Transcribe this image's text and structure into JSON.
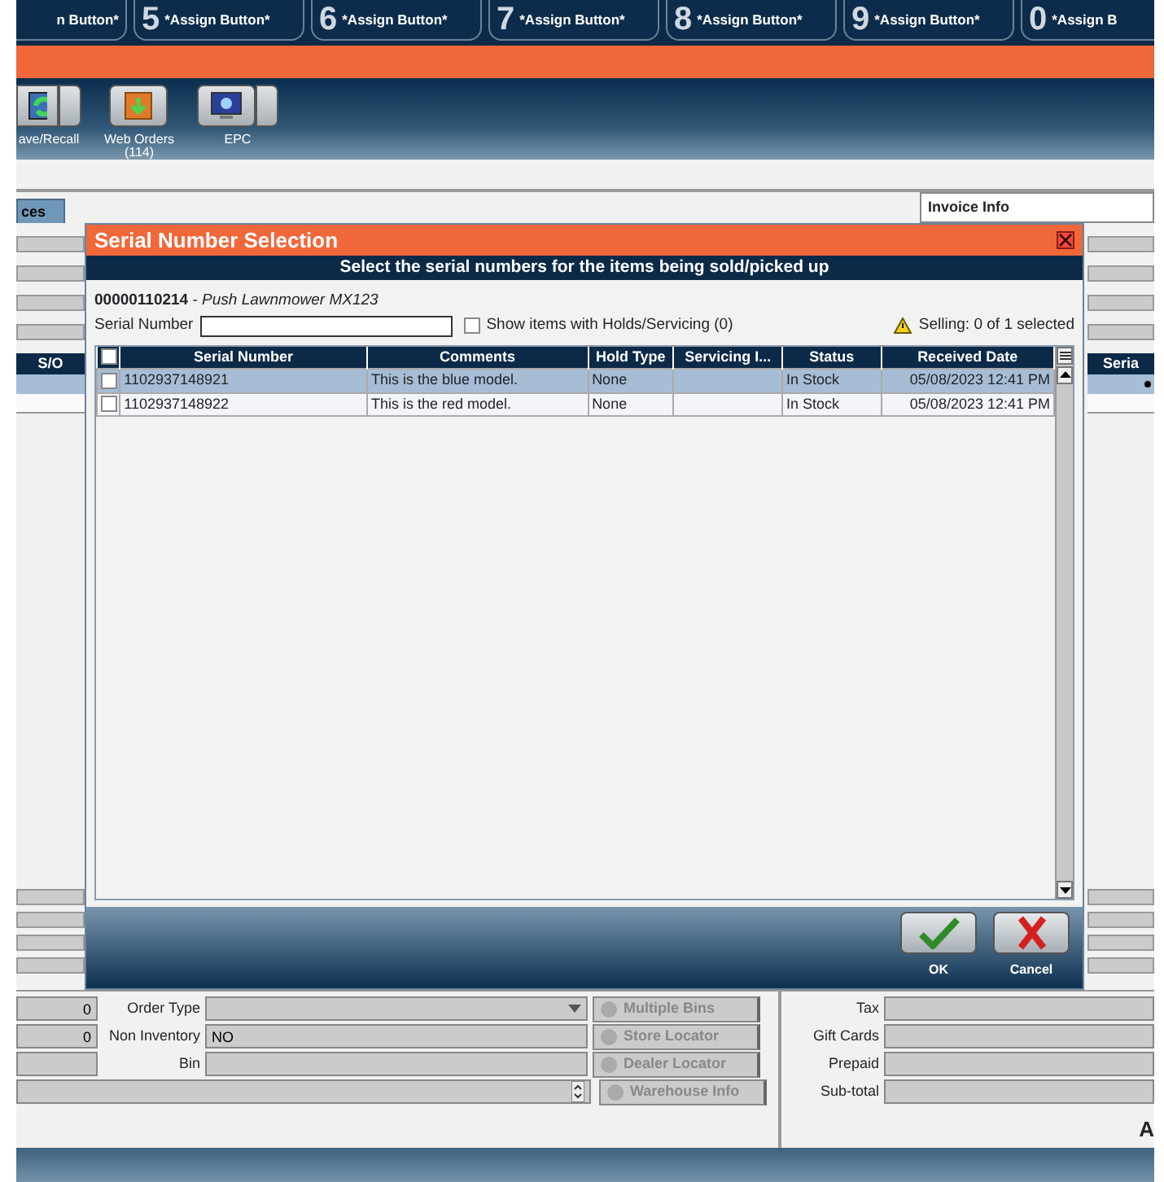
{
  "assign_buttons": [
    {
      "label": "n Button*"
    },
    {
      "key": "5",
      "label": "*Assign Button*"
    },
    {
      "key": "6",
      "label": "*Assign Button*"
    },
    {
      "key": "7",
      "label": "*Assign Button*"
    },
    {
      "key": "8",
      "label": "*Assign Button*"
    },
    {
      "key": "9",
      "label": "*Assign Button*"
    },
    {
      "key": "0",
      "label": "*Assign B"
    }
  ],
  "toolbar": [
    {
      "kind": "recall",
      "label": "ave/Recall",
      "has_menu": true
    },
    {
      "kind": "orders",
      "label": "Web Orders",
      "count": "(114)",
      "has_menu": false
    },
    {
      "kind": "epc",
      "label": "EPC",
      "has_menu": true
    }
  ],
  "tab": {
    "label": "ces"
  },
  "invoice_info": {
    "title": "Invoice Info"
  },
  "left_grid": {
    "header": "S/O"
  },
  "right_grid": {
    "header": "Seria"
  },
  "dialog": {
    "title": "Serial Number Selection",
    "subtitle": "Select the serial numbers for the items being sold/picked up",
    "item_number": "00000110214",
    "separator": "-",
    "item_name": "Push Lawnmower MX123",
    "select_all_checked": false,
    "serial_field": {
      "label": "Serial Number"
    },
    "show_holds": {
      "label": "Show items with Holds/Servicing (0)",
      "checked": false
    },
    "selling": "Selling: 0 of 1 selected",
    "columns": [
      "Serial Number",
      "Comments",
      "Hold Type",
      "Servicing I...",
      "Status",
      "Received Date"
    ],
    "rows": [
      {
        "selected": true,
        "checked": false,
        "cells": [
          "1102937148921",
          "This is the blue model.",
          "None",
          "",
          "In Stock",
          "05/08/2023 12:41 PM"
        ]
      },
      {
        "selected": false,
        "checked": false,
        "cells": [
          "1102937148922",
          "This is the red model.",
          "None",
          "",
          "In Stock",
          "05/08/2023 12:41 PM"
        ]
      }
    ],
    "buttons": [
      {
        "kind": "ok",
        "label": "OK"
      },
      {
        "kind": "cancel",
        "label": "Cancel"
      }
    ]
  },
  "form": {
    "left_values": [
      "0",
      "0"
    ],
    "order_type": {
      "label": "Order Type"
    },
    "non_inventory": {
      "label": "Non Inventory",
      "value": "NO"
    },
    "bin": {
      "label": "Bin"
    },
    "side_buttons": [
      "Multiple Bins",
      "Store Locator",
      "Dealer Locator",
      "Warehouse Info"
    ],
    "totals": [
      "Tax",
      "Gift Cards",
      "Prepaid",
      "Sub-total"
    ],
    "cut_label": "A"
  }
}
